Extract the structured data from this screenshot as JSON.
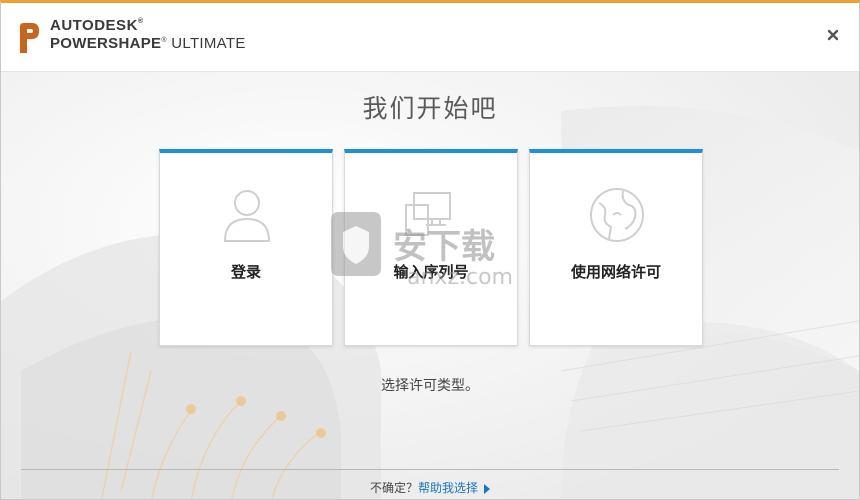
{
  "header": {
    "brand_top": "AUTODESK",
    "brand_bold": "POWERSHAPE",
    "brand_rest": " ULTIMATE",
    "close_icon": "close-icon"
  },
  "main": {
    "title": "我们开始吧",
    "cards": [
      {
        "label": "登录",
        "icon": "user-icon"
      },
      {
        "label": "输入序列号",
        "icon": "computer-icon"
      },
      {
        "label": "使用网络许可",
        "icon": "globe-icon"
      }
    ],
    "hint": "选择许可类型。"
  },
  "footer": {
    "prefix": "不确定？",
    "link": "帮助我选择"
  },
  "watermark": {
    "text": "安下载",
    "domain": "anxz.com"
  },
  "colors": {
    "accent_top": "#f0a030",
    "card_border": "#1e90d9",
    "link": "#1a74c9"
  }
}
